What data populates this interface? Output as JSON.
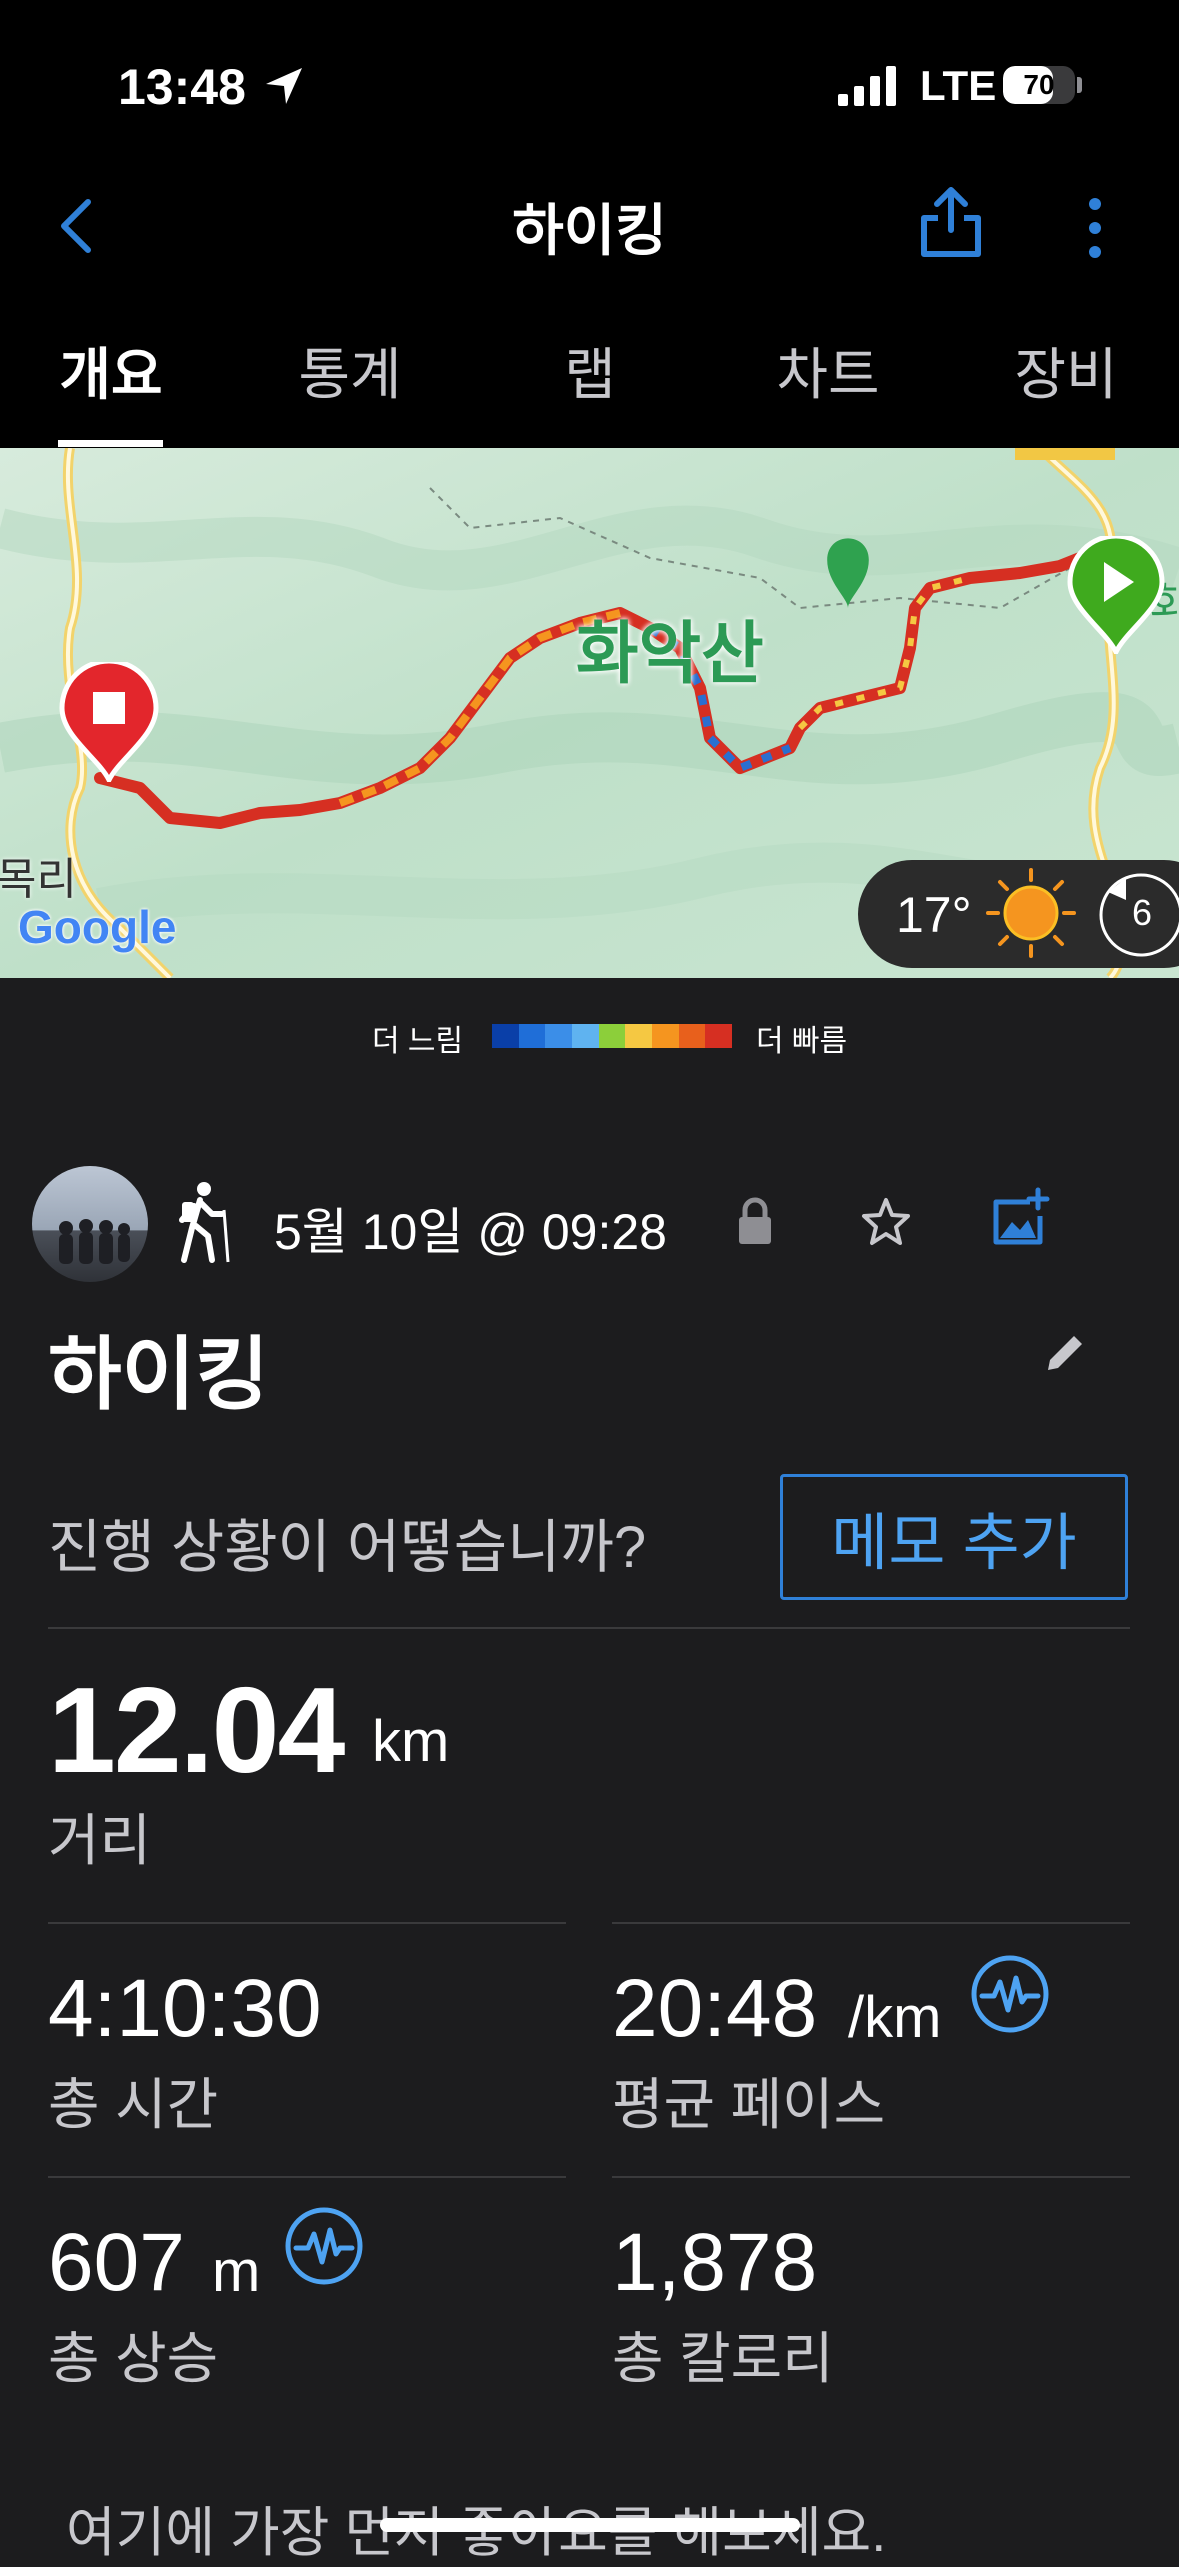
{
  "status_bar": {
    "time": "13:48",
    "network": "LTE",
    "battery": "70",
    "battery_level": 0.7
  },
  "header": {
    "title": "하이킹"
  },
  "tabs": [
    {
      "label": "개요",
      "active": true
    },
    {
      "label": "통계",
      "active": false
    },
    {
      "label": "랩",
      "active": false
    },
    {
      "label": "차트",
      "active": false
    },
    {
      "label": "장비",
      "active": false
    }
  ],
  "map": {
    "peak_name": "화악산",
    "left_label": "목리",
    "right_label": "화",
    "attribution": "Google",
    "weather": {
      "temperature": "17°",
      "wind": "6"
    }
  },
  "legend": {
    "slow": "더 느림",
    "fast": "더 빠름",
    "colors": [
      "#0a3fa8",
      "#1f6ed8",
      "#3b8ee8",
      "#5fb3f0",
      "#8ccf3a",
      "#f5c842",
      "#f5951f",
      "#e8601c",
      "#d62f22"
    ]
  },
  "activity": {
    "date": "5월 10일 @ 09:28",
    "title": "하이킹",
    "prompt": "진행 상황이 어떻습니까?",
    "memo_button": "메모 추가"
  },
  "stats": {
    "distance": {
      "value": "12.04",
      "unit": "km",
      "label": "거리"
    },
    "time": {
      "value": "4:10:30",
      "label": "총 시간"
    },
    "pace": {
      "value": "20:48",
      "unit": "/km",
      "label": "평균 페이스"
    },
    "ascent": {
      "value": "607",
      "unit": "m",
      "label": "총 상승"
    },
    "calories": {
      "value": "1,878",
      "label": "총 칼로리"
    }
  },
  "footer": {
    "like_prompt": "여기에 가장 먼저 좋아요를 해보세요."
  },
  "colors": {
    "accent": "#2f80d8",
    "route_red": "#d62f22",
    "start_green": "#3faa1e"
  }
}
